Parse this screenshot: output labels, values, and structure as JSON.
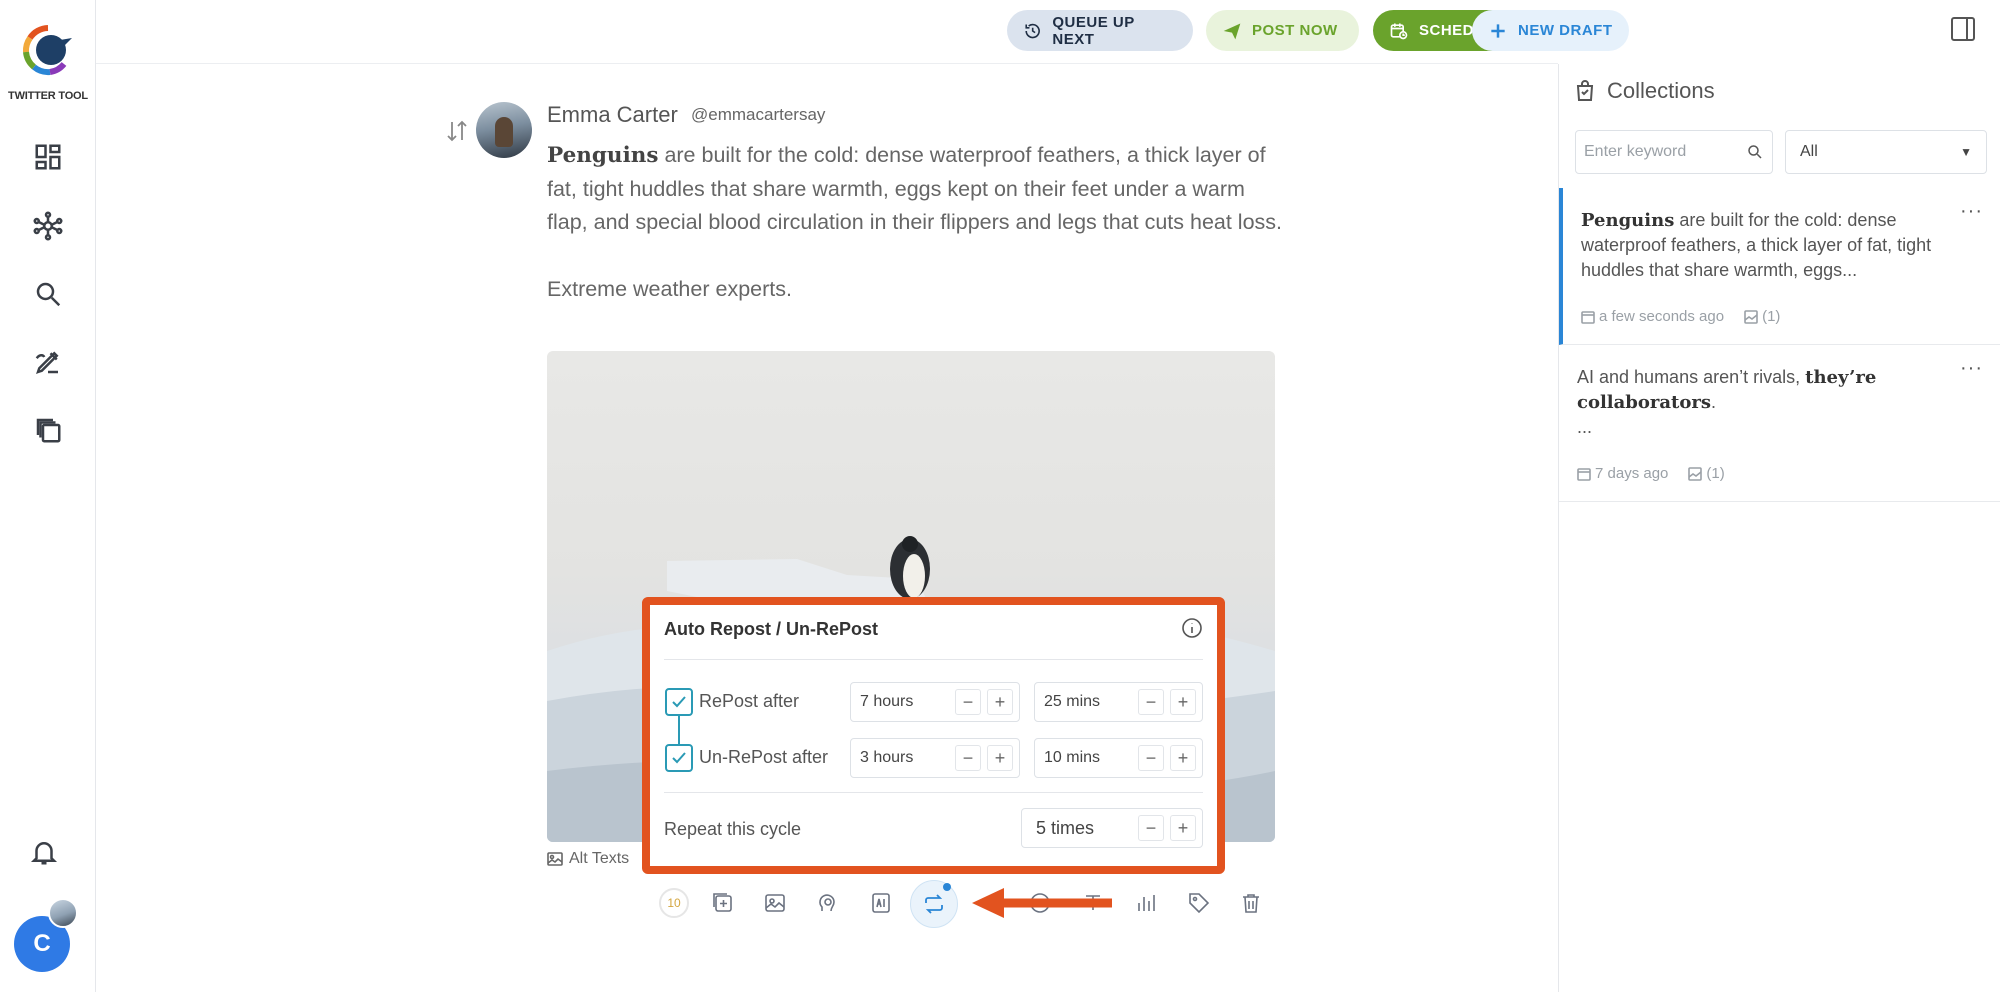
{
  "brand": {
    "name": "TWITTER TOOL",
    "logo_colors": [
      "#1e5a8c",
      "#e2531f",
      "#f2a93b",
      "#6aa32c",
      "#2a86d6",
      "#8a3ab9"
    ]
  },
  "sidebar": {
    "items": [
      {
        "icon": "dashboard-icon"
      },
      {
        "icon": "network-icon"
      },
      {
        "icon": "search-icon"
      },
      {
        "icon": "compose-icon"
      },
      {
        "icon": "copy-icon"
      }
    ],
    "notifications_icon": "bell-icon",
    "user_initial": "C"
  },
  "topbar": {
    "queue_label": "QUEUE UP NEXT",
    "post_now_label": "POST NOW",
    "schedule_label": "SCHEDULE",
    "new_draft_label": "NEW DRAFT"
  },
  "post": {
    "author_name": "Emma Carter",
    "author_handle": "@emmacartersay",
    "body_bold": "Penguins",
    "body_rest": " are built for the cold: dense waterproof feathers, a thick layer of fat, tight huddles that share warmth, eggs kept on their feet under a warm flap, and special blood circulation in their flippers and legs that cuts heat loss.",
    "body_p2": "Extreme weather experts.",
    "alt_texts_label": "Alt Texts",
    "char_counter": "10"
  },
  "repost_popup": {
    "title": "Auto Repost / Un-RePost",
    "repost": {
      "label": "RePost after",
      "checked": true,
      "hours": "7 hours",
      "mins": "25 mins"
    },
    "unrepost": {
      "label": "Un-RePost after",
      "checked": true,
      "hours": "3 hours",
      "mins": "10 mins"
    },
    "repeat": {
      "label": "Repeat this cycle",
      "value": "5 times"
    },
    "minus": "−",
    "plus": "+"
  },
  "collections": {
    "title": "Collections",
    "search_placeholder": "Enter keyword",
    "filter_value": "All",
    "items": [
      {
        "bold": "Penguins",
        "rest": " are built for the cold: dense waterproof feathers, a thick layer of fat, tight huddles that share warmth, eggs...",
        "time": "a few seconds ago",
        "images": "(1)",
        "active": true
      },
      {
        "pre": "AI and humans aren’t rivals, ",
        "bold": "they’re collaborators",
        "post": ".",
        "ellipsis": "...",
        "time": "7 days ago",
        "images": "(1)",
        "active": false
      }
    ],
    "more_label": "···"
  },
  "colors": {
    "accent_blue": "#2a86d6",
    "green": "#6aa32c",
    "annotation": "#e2531f",
    "teal": "#2a9ab5"
  }
}
